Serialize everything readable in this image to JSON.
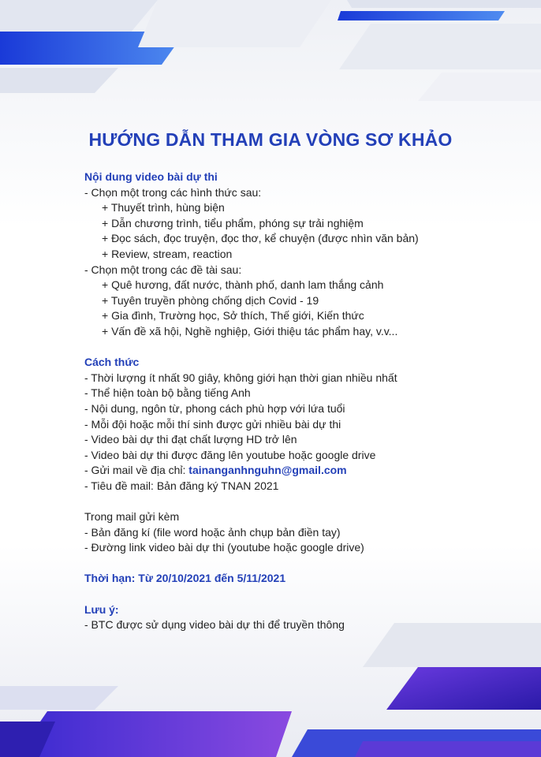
{
  "title": "HƯỚNG DẪN THAM GIA VÒNG SƠ KHẢO",
  "sec1": {
    "heading": "Nội dung video bài dự thi",
    "form_intro": "- Chọn một trong các hình thức sau:",
    "forms": [
      "+ Thuyết trình, hùng biện",
      "+ Dẫn chương trình, tiểu phẩm, phóng sự trải nghiệm",
      "+ Đọc sách, đọc truyện, đọc thơ, kể chuyện (được nhìn văn bản)",
      "+ Review, stream, reaction"
    ],
    "topic_intro": "- Chọn một trong các đề tài sau:",
    "topics": [
      "+ Quê hương, đất nước, thành phố, danh lam thắng cảnh",
      "+ Tuyên truyền phòng chống dịch Covid - 19",
      "+ Gia đình, Trường học, Sở thích, Thế giới, Kiến thức",
      "+ Vấn đề xã hội, Nghề nghiệp, Giới thiệu tác phẩm hay, v.v..."
    ]
  },
  "sec2": {
    "heading": "Cách thức",
    "items": [
      "- Thời lượng ít nhất 90 giây, không giới hạn thời gian nhiều nhất",
      "- Thể hiện toàn bộ bằng tiếng Anh",
      "- Nội dung, ngôn từ, phong cách phù hợp với lứa tuổi",
      "- Mỗi đội hoặc mỗi thí sinh được gửi nhiều bài dự thi",
      "- Video bài dự thi đạt chất lượng HD trở lên",
      "- Video bài dự thi được đăng lên youtube hoặc google drive"
    ],
    "mail_prefix": "- Gửi mail về địa chỉ: ",
    "mail_address": "tainanganhnguhn@gmail.com",
    "subject": "- Tiêu đề mail: Bản đăng ký TNAN 2021"
  },
  "sec3": {
    "heading": "Trong mail gửi kèm",
    "items": [
      "- Bản đăng kí (file word hoặc ảnh chụp bản điền tay)",
      "- Đường link video bài dự thi (youtube hoặc google drive)"
    ]
  },
  "deadline": "Thời hạn: Từ 20/10/2021 đến 5/11/2021",
  "note": {
    "heading": "Lưu ý:",
    "items": [
      "- BTC được sử dụng video bài dự thi để truyền thông"
    ]
  },
  "colors": {
    "accent": "#2340b8",
    "deco_blue": "#1f3fcf",
    "deco_purple": "#5a2fd0"
  }
}
